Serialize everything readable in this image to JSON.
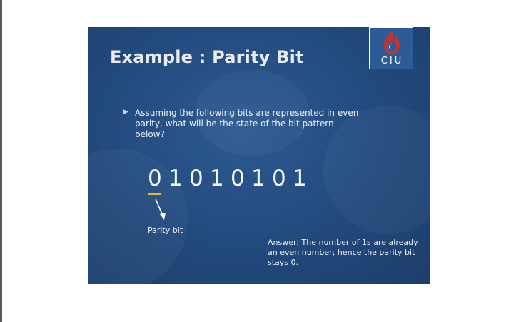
{
  "slide": {
    "title": "Example : Parity Bit",
    "logo_text": "CIU",
    "bullet": "Assuming the following bits are represented in even parity, what will be the state of the bit pattern below?",
    "bits": [
      "0",
      "1",
      "0",
      "1",
      "0",
      "1",
      "0",
      "1"
    ],
    "parity_label": "Parity bit",
    "answer": "Answer: The number of 1s are already an even number; hence the parity bit stays 0."
  },
  "colors": {
    "slide_background": "#22497c",
    "text": "#eef1f6",
    "underline_accent": "#e6b92e",
    "logo_flame": "#c8312e"
  },
  "icons": {
    "bullet": "triangle-right-icon",
    "logo": "flame-logo-icon",
    "pointer": "arrow-down-icon"
  }
}
